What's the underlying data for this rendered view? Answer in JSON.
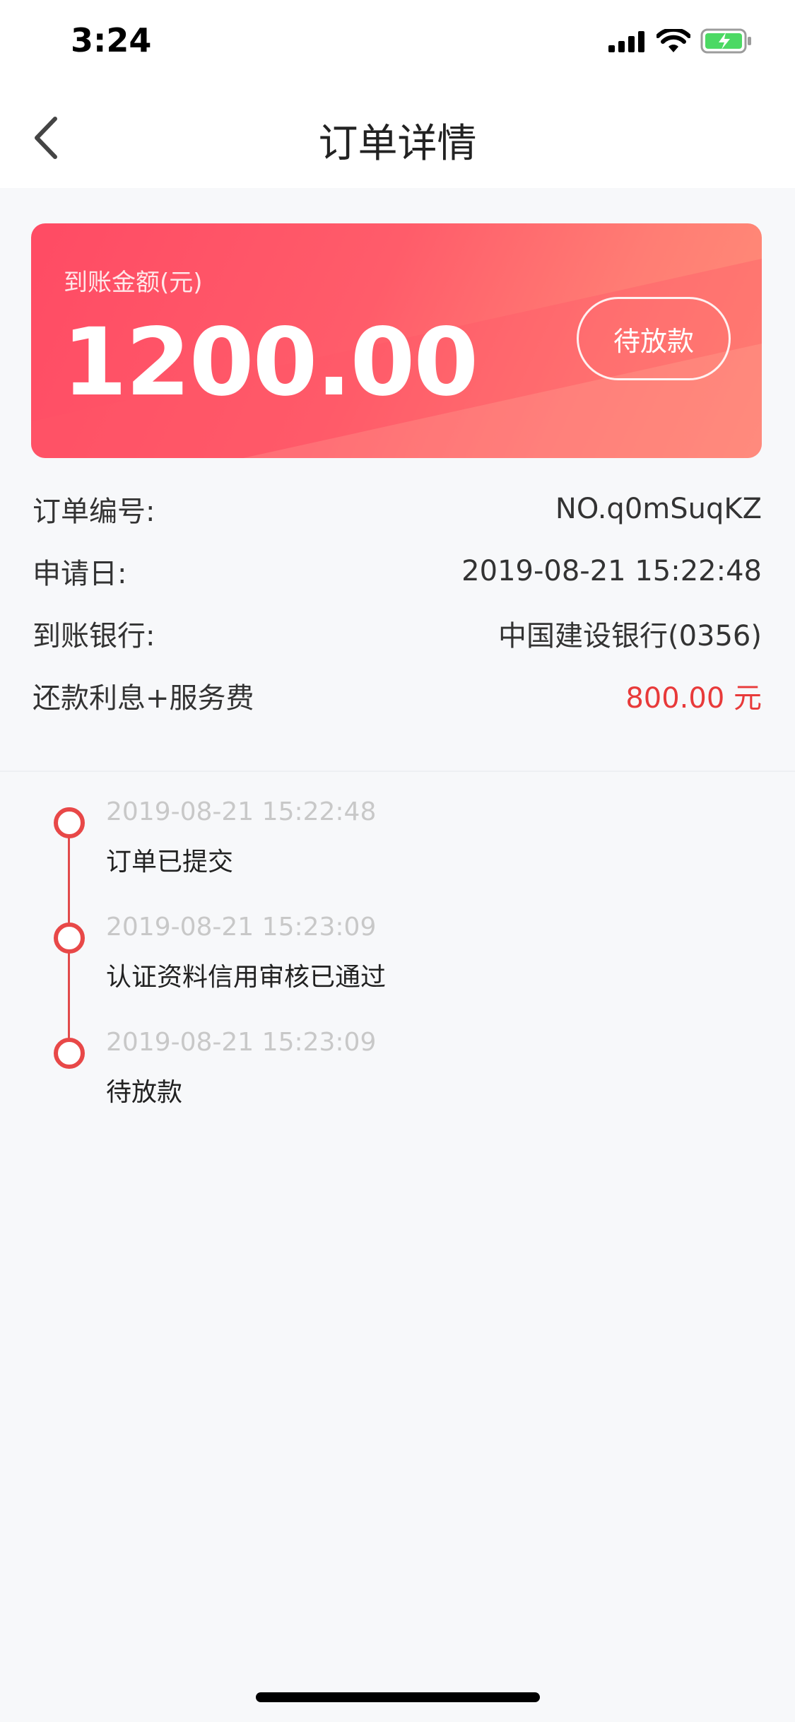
{
  "status_bar": {
    "time": "3:24"
  },
  "navbar": {
    "title": "订单详情"
  },
  "amount_card": {
    "label": "到账金额(元)",
    "amount": "1200.00",
    "status": "待放款"
  },
  "info": [
    {
      "label": "订单编号:",
      "value": "NO.q0mSuqKZ"
    },
    {
      "label": "申请日:",
      "value": "2019-08-21 15:22:48"
    },
    {
      "label": "到账银行:",
      "value": "中国建设银行(0356)"
    },
    {
      "label": "还款利息+服务费",
      "value": "800.00 元"
    }
  ],
  "timeline": [
    {
      "time": "2019-08-21 15:22:48",
      "text": "订单已提交"
    },
    {
      "time": "2019-08-21 15:23:09",
      "text": "认证资料信用审核已通过"
    },
    {
      "time": "2019-08-21 15:23:09",
      "text": "待放款"
    }
  ],
  "colors": {
    "accent": "#e84848",
    "fee_red": "#e83a3a",
    "card_start": "#ff4b64",
    "card_end": "#ff8f78"
  },
  "icons": [
    "signal-icon",
    "wifi-icon",
    "battery-icon",
    "back-chevron-icon"
  ]
}
